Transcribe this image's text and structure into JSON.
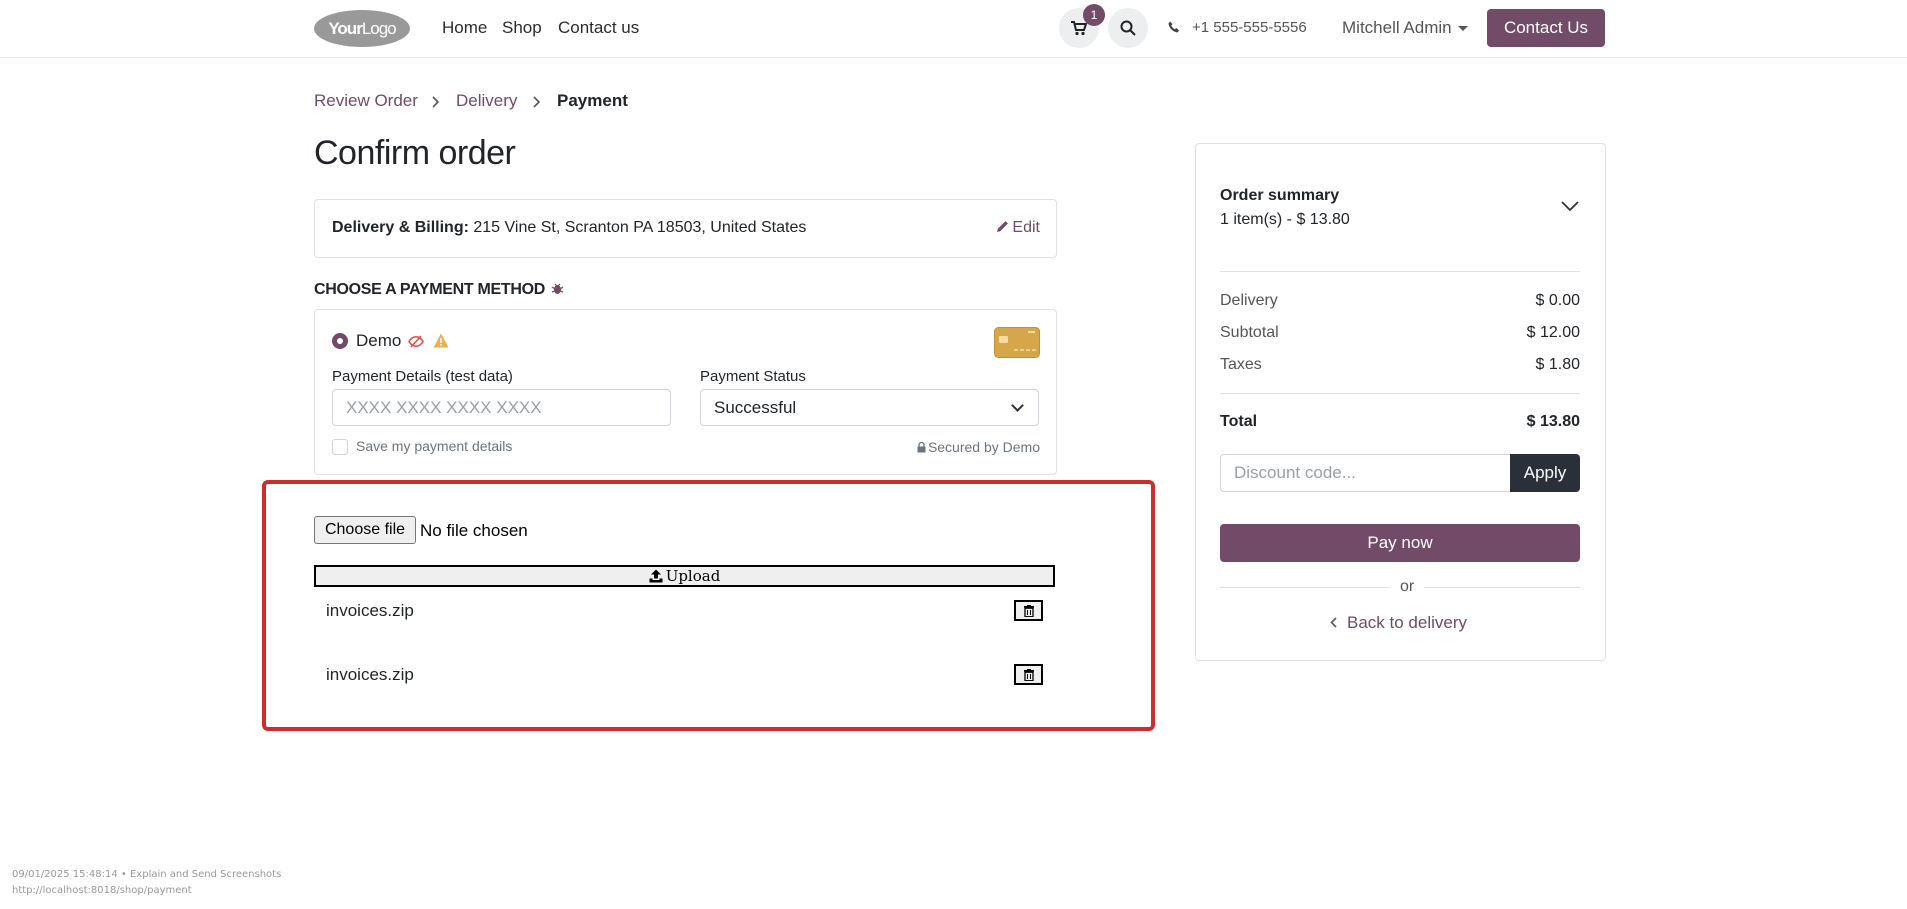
{
  "navbar": {
    "logo_bold": "Your",
    "logo_light": "Logo",
    "links": [
      "Home",
      "Shop",
      "Contact us"
    ],
    "cart_count": "1",
    "phone": "+1 555-555-5556",
    "user": "Mitchell Admin",
    "contact_button": "Contact Us"
  },
  "breadcrumb": {
    "step1": "Review Order",
    "step2": "Delivery",
    "step3": "Payment"
  },
  "page_title": "Confirm order",
  "address": {
    "label": "Delivery & Billing:",
    "value": "215 Vine St, Scranton PA 18503, United States",
    "edit": "Edit"
  },
  "payment": {
    "section_title": "CHOOSE A PAYMENT METHOD",
    "method_name": "Demo",
    "details_label": "Payment Details (test data)",
    "details_placeholder": "XXXX XXXX XXXX XXXX",
    "status_label": "Payment Status",
    "status_value": "Successful",
    "save_details": "Save my payment details",
    "secured_by": "Secured by Demo"
  },
  "upload": {
    "choose_file": "Choose file",
    "file_status": "No file chosen",
    "upload_label": "Upload",
    "files": [
      "invoices.zip",
      "invoices.zip"
    ]
  },
  "summary": {
    "title": "Order summary",
    "items_line": "1 item(s) -  $ 13.80",
    "delivery_label": "Delivery",
    "delivery_value": "$ 0.00",
    "subtotal_label": "Subtotal",
    "subtotal_value": "$ 12.00",
    "taxes_label": "Taxes",
    "taxes_value": "$ 1.80",
    "total_label": "Total",
    "total_value": "$ 13.80",
    "discount_placeholder": "Discount code...",
    "apply": "Apply",
    "pay_now": "Pay now",
    "or": "or",
    "back": "Back to delivery"
  },
  "footer": {
    "stamp": "09/01/2025 15:48:14 • Explain and Send Screenshots",
    "url": "http://localhost:8018/shop/payment"
  },
  "colors": {
    "brand": "#714b67",
    "highlight": "#cc2e2e",
    "dark_button": "#2b2f3a"
  }
}
